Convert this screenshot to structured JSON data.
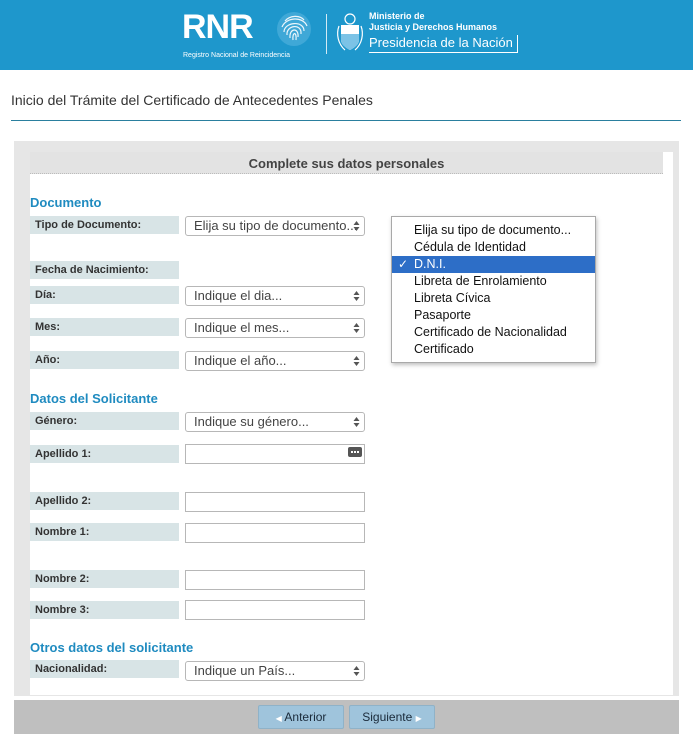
{
  "header": {
    "logo_text": "RNR",
    "logo_subtitle": "Registro Nacional de Reincidencia",
    "ministry_line1": "Ministerio de",
    "ministry_line2": "Justicia y Derechos Humanos",
    "presidencia": "Presidencia de la Nación",
    "colors": {
      "bar": "#1e97cc"
    }
  },
  "page_title": "Inicio del Trámite del Certificado de Antecedentes Penales",
  "form": {
    "section_bar": "Complete sus datos personales",
    "documento": {
      "heading": "Documento",
      "tipo_label": "Tipo de Documento:",
      "tipo_value": "Elija su tipo de documento...",
      "fecha_label": "Fecha de Nacimiento:",
      "dia_label": "Día:",
      "dia_value": "Indique el dia...",
      "mes_label": "Mes:",
      "mes_value": "Indique el mes...",
      "anio_label": "Año:",
      "anio_value": "Indique el año..."
    },
    "solicitante": {
      "heading": "Datos del Solicitante",
      "genero_label": "Género:",
      "genero_value": "Indique su género...",
      "apellido1_label": "Apellido 1:",
      "apellido2_label": "Apellido 2:",
      "nombre1_label": "Nombre 1:",
      "nombre2_label": "Nombre 2:",
      "nombre3_label": "Nombre 3:"
    },
    "otros": {
      "heading": "Otros datos del solicitante",
      "nacionalidad_label": "Nacionalidad:",
      "nacionalidad_value": "Indique un País..."
    }
  },
  "dropdown": {
    "options": [
      "Elija su tipo de documento...",
      "Cédula de Identidad",
      "D.N.I.",
      "Libreta de Enrolamiento",
      "Libreta Cívica",
      "Pasaporte",
      "Certificado de Nacionalidad",
      "Certificado"
    ],
    "selected": "D.N.I.",
    "check": "✓",
    "colors": {
      "highlight": "#2d6ec7"
    }
  },
  "footer": {
    "prev_label": "Anterior",
    "next_label": "Siguiente"
  }
}
